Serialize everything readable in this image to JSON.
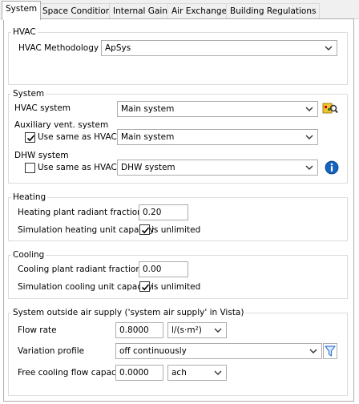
{
  "tabs": [
    {
      "label": "System",
      "active": true
    },
    {
      "label": "Space Conditions",
      "active": false
    },
    {
      "label": "Internal Gains",
      "active": false
    },
    {
      "label": "Air Exchanges",
      "active": false
    },
    {
      "label": "Building Regulations",
      "active": false
    }
  ],
  "hvac": {
    "group_title": "HVAC",
    "methodology_label": "HVAC Methodology",
    "methodology_value": "ApSys"
  },
  "system": {
    "group_title": "System",
    "hvac_system_label": "HVAC system",
    "hvac_system_value": "Main system",
    "aux_vent_label": "Auxiliary vent. system",
    "aux_use_same_label": "Use same as HVAC",
    "aux_use_same_checked": true,
    "aux_vent_value": "Main system",
    "dhw_label": "DHW system",
    "dhw_use_same_label": "Use same as HVAC",
    "dhw_use_same_checked": false,
    "dhw_value": "DHW system"
  },
  "heating": {
    "group_title": "Heating",
    "radiant_label": "Heating plant radiant fraction",
    "radiant_value": "0.20",
    "capacity_label": "Simulation heating unit capacity",
    "unlimited_label": "is unlimited",
    "unlimited_checked": true
  },
  "cooling": {
    "group_title": "Cooling",
    "radiant_label": "Cooling plant radiant fraction",
    "radiant_value": "0.00",
    "capacity_label": "Simulation cooling unit capacity",
    "unlimited_label": "is unlimited",
    "unlimited_checked": true
  },
  "outside_air": {
    "group_title": "System outside air supply ('system air supply' in Vista)",
    "flow_rate_label": "Flow rate",
    "flow_rate_value": "0.8000",
    "flow_rate_unit": "l/(s·m²)",
    "variation_label": "Variation profile",
    "variation_value": "off continuously",
    "free_cooling_label": "Free cooling flow capacity",
    "free_cooling_value": "0.0000",
    "free_cooling_unit": "ach"
  },
  "icons": {
    "system_browse": "system-browse-icon",
    "dhw_info": "info-icon",
    "variation_filter": "filter-icon"
  },
  "colors": {
    "info_blue": "#1565c0",
    "filter_blue": "#3a7bd5",
    "border": "#adadad"
  }
}
